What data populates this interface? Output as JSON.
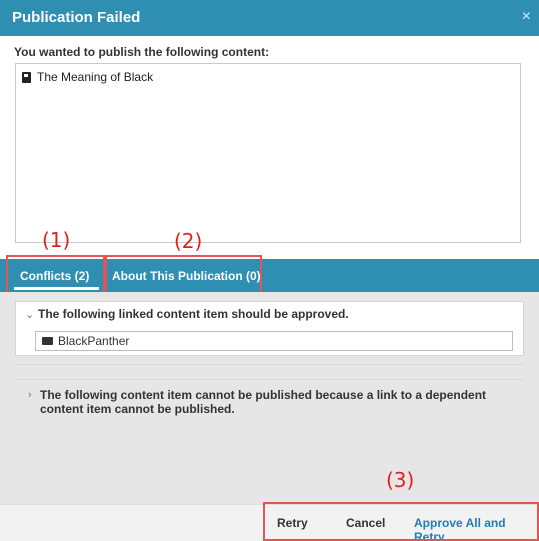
{
  "dialog": {
    "title": "Publication Failed",
    "close_symbol": "×",
    "intro": "You wanted to publish the following content:",
    "content_items": [
      {
        "icon": "page-icon",
        "label": "The Meaning of Black"
      }
    ]
  },
  "annotations": {
    "a1": "(1)",
    "a2": "(2)",
    "a3": "(3)",
    "color": "#e0211d"
  },
  "tabs": [
    {
      "label": "Conflicts (2)",
      "active": true
    },
    {
      "label": "About This Publication (0)",
      "active": false
    }
  ],
  "conflicts": [
    {
      "heading": "The following linked content item should be approved.",
      "expanded": true,
      "items": [
        {
          "icon": "film-icon",
          "label": "BlackPanther"
        }
      ]
    },
    {
      "heading": "The following content item cannot be published because a link to a dependent content item cannot be published.",
      "expanded": false
    }
  ],
  "footer": {
    "retry": "Retry",
    "cancel": "Cancel",
    "approve": "Approve All and Retry"
  },
  "colors": {
    "header": "#2e8fb3",
    "link": "#1f7fb0",
    "highlight": "#e05555"
  }
}
